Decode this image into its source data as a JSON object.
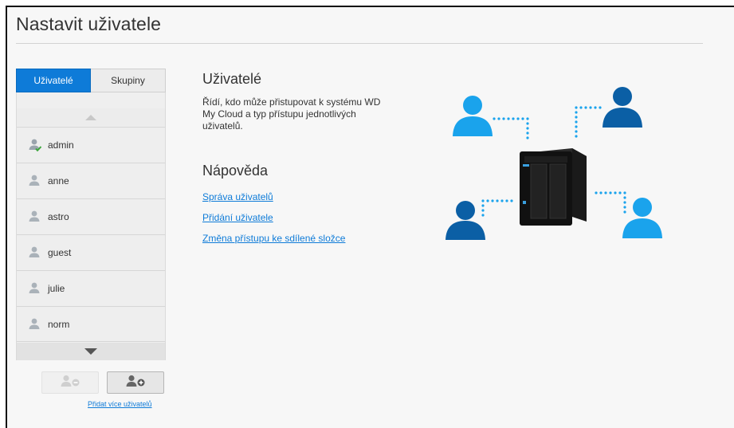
{
  "page": {
    "title": "Nastavit uživatele"
  },
  "tabs": [
    {
      "label": "Uživatelé",
      "active": true
    },
    {
      "label": "Skupiny",
      "active": false
    }
  ],
  "users": [
    {
      "name": "admin",
      "icon": "admin-user-icon"
    },
    {
      "name": "anne",
      "icon": "user-icon"
    },
    {
      "name": "astro",
      "icon": "user-icon"
    },
    {
      "name": "guest",
      "icon": "user-icon"
    },
    {
      "name": "julie",
      "icon": "user-icon"
    },
    {
      "name": "norm",
      "icon": "user-icon"
    }
  ],
  "buttons": {
    "remove_icon": "remove-user-icon",
    "add_icon": "add-user-icon",
    "add_more_label": "Přidat více uživatelů"
  },
  "info": {
    "title": "Uživatelé",
    "description": "Řídí, kdo může přistupovat k systému WD My Cloud a typ přístupu jednotlivých uživatelů."
  },
  "help": {
    "title": "Nápověda",
    "links": [
      "Správa uživatelů",
      "Přidání uživatele",
      "Změna přístupu ke sdílené složce"
    ]
  },
  "colors": {
    "accent": "#0e7bd8",
    "user_dark": "#0b5fa5",
    "user_light": "#1aa3ec"
  }
}
